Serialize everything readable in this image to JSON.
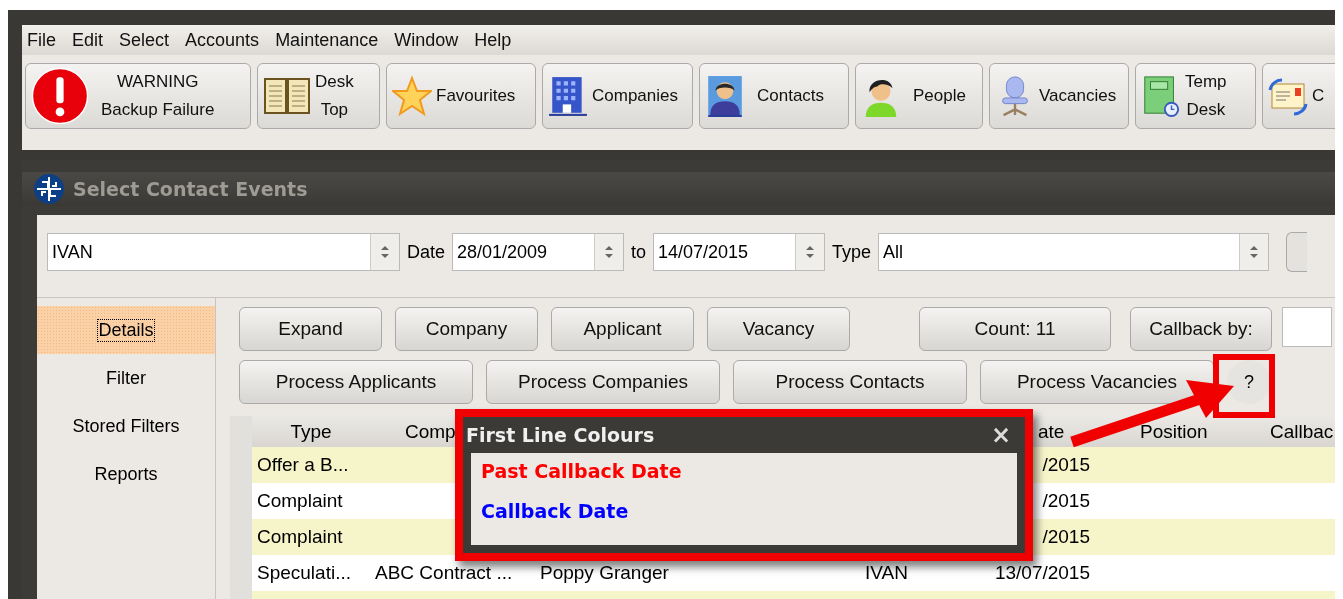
{
  "menu": [
    "File",
    "Edit",
    "Select",
    "Accounts",
    "Maintenance",
    "Window",
    "Help"
  ],
  "toolbar": [
    {
      "kind": "warning",
      "lines": [
        "WARNING",
        "Backup Failure"
      ]
    },
    {
      "kind": "desk",
      "lines": [
        "Desk",
        "Top"
      ]
    },
    {
      "kind": "favourites",
      "lines": [
        "Favourites"
      ]
    },
    {
      "kind": "companies",
      "lines": [
        "Companies"
      ]
    },
    {
      "kind": "contacts",
      "lines": [
        "Contacts"
      ]
    },
    {
      "kind": "people",
      "lines": [
        "People"
      ]
    },
    {
      "kind": "vacancies",
      "lines": [
        "Vacancies"
      ]
    },
    {
      "kind": "tempdesk",
      "lines": [
        "Temp",
        "Desk"
      ]
    },
    {
      "kind": "mail",
      "lines": [
        "C"
      ]
    }
  ],
  "window": {
    "title": "Select Contact Events"
  },
  "filters": {
    "user": "IVAN",
    "date_label": "Date",
    "date_from": "28/01/2009",
    "to_label": "to",
    "date_to": "14/07/2015",
    "type_label": "Type",
    "type": "All"
  },
  "side_tabs": [
    {
      "label": "Details",
      "selected": true
    },
    {
      "label": "Filter",
      "selected": false
    },
    {
      "label": "Stored Filters",
      "selected": false
    },
    {
      "label": "Reports",
      "selected": false
    }
  ],
  "buttons_row_1": [
    "Expand",
    "Company",
    "Applicant",
    "Vacancy"
  ],
  "count": "Count: 11",
  "callback_by": "Callback by:",
  "buttons_row_2": [
    "Process Applicants",
    "Process Companies",
    "Process Contacts",
    "Process Vacancies"
  ],
  "help_button": "?",
  "table": {
    "columns": [
      {
        "label": "Type"
      },
      {
        "label": "Comp"
      },
      {
        "label": "ate"
      },
      {
        "label": "Position"
      },
      {
        "label": "Callbac"
      }
    ],
    "rows": [
      {
        "type": "Offer a B...",
        "date": "/2015"
      },
      {
        "type": "Complaint",
        "date": "/2015"
      },
      {
        "type": "Complaint",
        "date": "/2015"
      },
      {
        "type": "Speculati...",
        "company": "ABC Contract ...",
        "contact": "Poppy Granger",
        "consultant": "IVAN",
        "date": "13/07/2015"
      }
    ]
  },
  "popup": {
    "title": "First Line Colours",
    "close": "×",
    "items": [
      {
        "label": "Past Callback Date",
        "color": "#ff0000"
      },
      {
        "label": "Callback Date",
        "color": "#0000ff"
      }
    ]
  }
}
